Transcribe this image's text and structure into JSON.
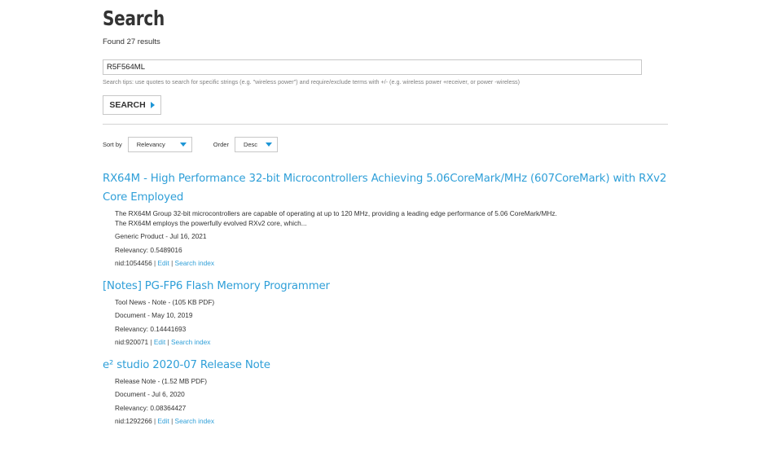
{
  "header": {
    "title": "Search",
    "found_text": "Found 27 results"
  },
  "search": {
    "value": "R5F564ML",
    "tips": "Search tips: use quotes to search for specific strings (e.g. \"wireless power\") and require/exclude terms with +/- (e.g. wireless power +receiver, or power -wireless)",
    "button_label": "SEARCH"
  },
  "sort": {
    "sort_by_label": "Sort by",
    "sort_by_value": "Relevancy",
    "order_label": "Order",
    "order_value": "Desc"
  },
  "results": [
    {
      "title_line1": "RX64M - High Performance 32-bit Microcontrollers Achieving 5.06CoreMark/MHz (607CoreMark) with RXv2",
      "title_line2": "Core Employed",
      "desc_line1": "The RX64M Group 32-bit microcontrollers are capable of operating at up to 120 MHz, providing a leading edge performance of 5.06 CoreMark/MHz.",
      "desc_line2": "The RX64M employs the powerfully evolved RXv2 core, which...",
      "type_date": "Generic Product - Jul 16, 2021",
      "relevancy": "Relevancy: 0.5489016",
      "nid": "nid:1054456",
      "edit_label": "Edit",
      "index_label": "Search index"
    },
    {
      "title": "[Notes] PG-FP6 Flash Memory Programmer",
      "info": "Tool News - Note - (105 KB PDF)",
      "type_date": "Document - May 10, 2019",
      "relevancy": "Relevancy: 0.14441693",
      "nid": "nid:920071",
      "edit_label": "Edit",
      "index_label": "Search index"
    },
    {
      "title": "e² studio 2020-07 Release Note",
      "info": "Release Note - (1.52 MB PDF)",
      "type_date": "Document - Jul 6, 2020",
      "relevancy": "Relevancy: 0.08364427",
      "nid": "nid:1292266",
      "edit_label": "Edit",
      "index_label": "Search index"
    }
  ],
  "separator": "|",
  "colors": {
    "link": "#2f9fd8",
    "accent": "#1e96d6",
    "text": "#333333",
    "muted": "#808080",
    "border": "#c8c8c8"
  },
  "icons": {
    "button_arrow": "caret-right-icon",
    "select_caret": "caret-down-icon"
  }
}
